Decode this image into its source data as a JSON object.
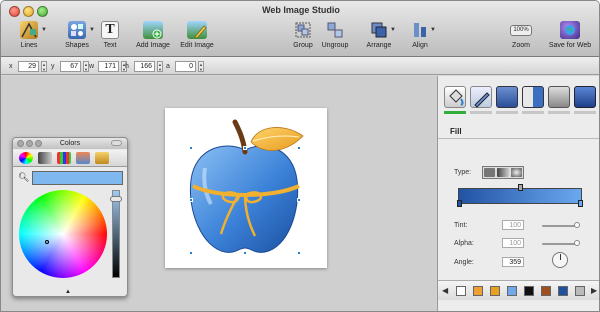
{
  "window": {
    "title": "Web Image Studio"
  },
  "toolbar": {
    "lines": "Lines",
    "shapes": "Shapes",
    "text": "Text",
    "add_image": "Add Image",
    "edit_image": "Edit Image",
    "group": "Group",
    "ungroup": "Ungroup",
    "arrange": "Arrange",
    "align": "Align",
    "zoom": "Zoom",
    "zoom_value": "100%",
    "save_for_web": "Save for Web",
    "text_icon_glyph": "T"
  },
  "options_bar": {
    "x_label": "x",
    "x_value": "29",
    "y_label": "y",
    "y_value": "67",
    "w_label": "w",
    "w_value": "171",
    "h_label": "h",
    "h_value": "166",
    "a_label": "a",
    "a_value": "0"
  },
  "colors_panel": {
    "title": "Colors",
    "current_color": "#7eb8ee"
  },
  "inspector": {
    "section": "Fill",
    "type_label": "Type:",
    "tint_label": "Tint:",
    "tint_value": "100",
    "alpha_label": "Alpha:",
    "alpha_value": "100",
    "angle_label": "Angle:",
    "angle_value": "359",
    "gradient_start": "#2252a4",
    "gradient_end": "#6aa8ef",
    "palette": [
      "#ffffff",
      "#f0a030",
      "#e8a020",
      "#6fa8e8",
      "#111111",
      "#a05020",
      "#2050a0",
      "#bbbbbb"
    ]
  },
  "colors": {
    "apple_body": "#3b82d8",
    "leaf": "#f1b23a",
    "ribbon": "#f0b030",
    "selection": "#2a7fd3"
  }
}
